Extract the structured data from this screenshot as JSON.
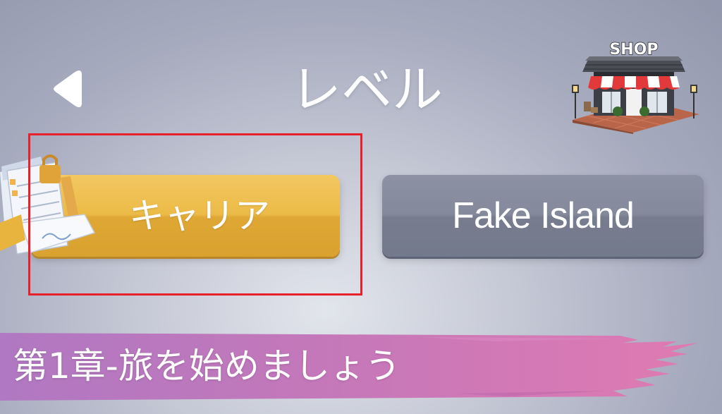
{
  "header": {
    "title": "レベル",
    "shop_sign": "SHOP"
  },
  "levels": {
    "career_label": "キャリア",
    "fake_island_label": "Fake Island"
  },
  "chapter": {
    "label": "第1章-旅を始めましょう"
  },
  "colors": {
    "career_button": "#ecbb47",
    "fake_island_button": "#848a9c",
    "banner_pink": "#d86fb6",
    "highlight": "#e8202a"
  },
  "icons": {
    "back": "back-arrow-icon",
    "shop": "shop-storefront-icon",
    "career": "clipboard-documents-icon"
  }
}
